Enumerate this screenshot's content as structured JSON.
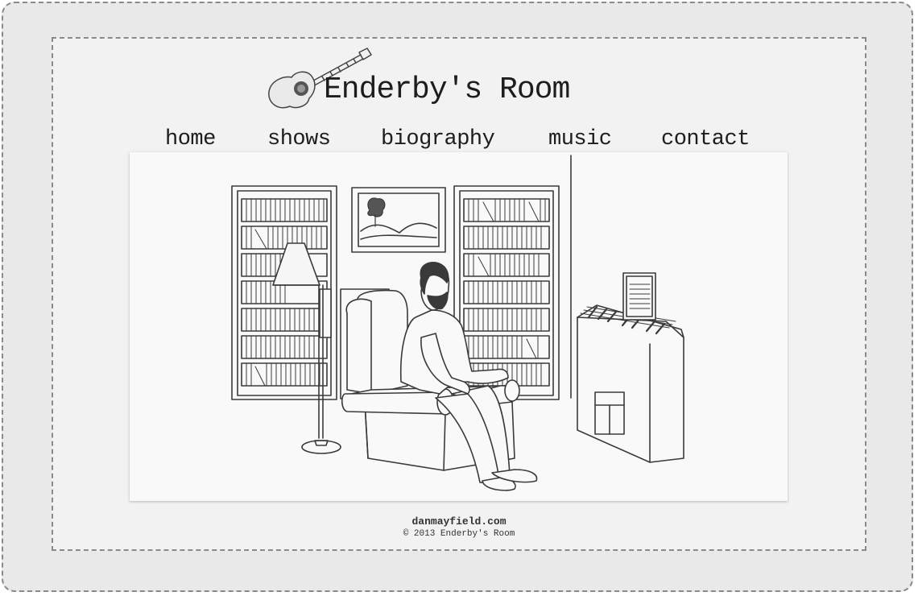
{
  "header": {
    "title": "Enderby's Room",
    "logo_icon": "guitar-icon"
  },
  "nav": {
    "items": [
      {
        "label": "home"
      },
      {
        "label": "shows"
      },
      {
        "label": "biography"
      },
      {
        "label": "music"
      },
      {
        "label": "contact"
      }
    ]
  },
  "hero": {
    "illustration": "room-illustration"
  },
  "footer": {
    "site": "danmayfield.com",
    "copyright": "© 2013 Enderby's Room"
  },
  "colors": {
    "page_background": "#e9e9e9",
    "panel_background": "#f1f2f1",
    "border": "#8a8a8a",
    "text": "#1d1d1d"
  }
}
